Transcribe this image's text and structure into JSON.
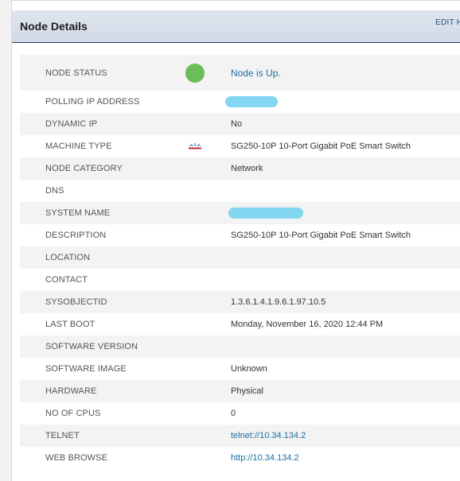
{
  "header": {
    "title": "Node Details",
    "edit_label": "EDIT H"
  },
  "status_color": "#6abd5a",
  "rows": [
    {
      "label": "NODE STATUS",
      "value": "Node is Up."
    },
    {
      "label": "POLLING IP ADDRESS",
      "value": ""
    },
    {
      "label": "DYNAMIC IP",
      "value": "No"
    },
    {
      "label": "MACHINE TYPE",
      "value": "SG250-10P 10-Port Gigabit PoE Smart Switch",
      "icon": "cisco-logo-icon"
    },
    {
      "label": "NODE CATEGORY",
      "value": "Network"
    },
    {
      "label": "DNS",
      "value": ""
    },
    {
      "label": "SYSTEM NAME",
      "value": ""
    },
    {
      "label": "DESCRIPTION",
      "value": "SG250-10P 10-Port Gigabit PoE Smart Switch"
    },
    {
      "label": "LOCATION",
      "value": ""
    },
    {
      "label": "CONTACT",
      "value": ""
    },
    {
      "label": "SYSOBJECTID",
      "value": "1.3.6.1.4.1.9.6.1.97.10.5"
    },
    {
      "label": "LAST BOOT",
      "value": "Monday, November 16, 2020 12:44 PM"
    },
    {
      "label": "SOFTWARE VERSION",
      "value": ""
    },
    {
      "label": "SOFTWARE IMAGE",
      "value": "Unknown"
    },
    {
      "label": "HARDWARE",
      "value": "Physical"
    },
    {
      "label": "NO OF CPUS",
      "value": "0"
    },
    {
      "label": "TELNET",
      "value": "telnet://10.34.134.2"
    },
    {
      "label": "WEB BROWSE",
      "value": "http://10.34.134.2"
    }
  ]
}
